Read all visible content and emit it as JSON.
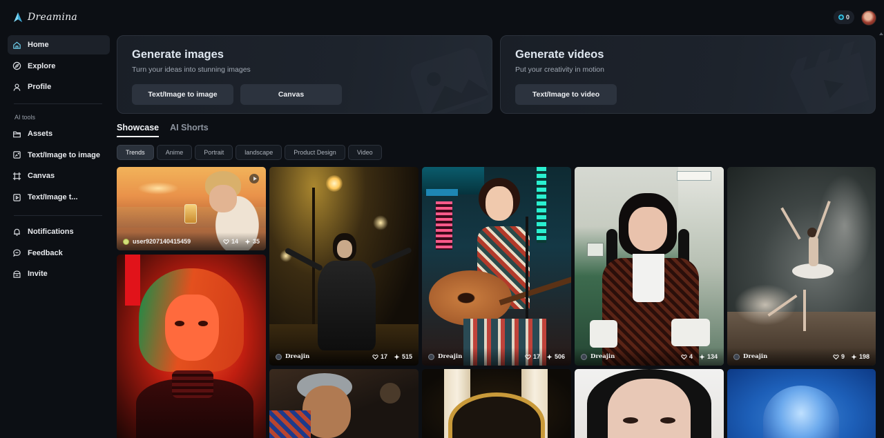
{
  "app": {
    "name": "Dreamina"
  },
  "sidebar": {
    "nav": [
      {
        "label": "Home",
        "icon": "home-icon",
        "active": true
      },
      {
        "label": "Explore",
        "icon": "compass-icon"
      },
      {
        "label": "Profile",
        "icon": "user-icon"
      }
    ],
    "tools_label": "AI tools",
    "tools": [
      {
        "label": "Assets",
        "icon": "folder-icon"
      },
      {
        "label": "Text/Image to image",
        "icon": "image-generate-icon"
      },
      {
        "label": "Canvas",
        "icon": "canvas-icon"
      },
      {
        "label": "Text/Image t...",
        "icon": "video-generate-icon"
      }
    ],
    "footer": [
      {
        "label": "Notifications",
        "icon": "bell-icon"
      },
      {
        "label": "Feedback",
        "icon": "chat-icon"
      },
      {
        "label": "Invite",
        "icon": "gift-icon"
      }
    ]
  },
  "header": {
    "credits": "0"
  },
  "hero": {
    "images": {
      "title": "Generate images",
      "subtitle": "Turn your ideas into stunning images",
      "buttons": [
        "Text/Image to image",
        "Canvas"
      ]
    },
    "videos": {
      "title": "Generate videos",
      "subtitle": "Put your creativity in motion",
      "buttons": [
        "Text/Image to video"
      ]
    }
  },
  "tabs": [
    "Showcase",
    "AI Shorts"
  ],
  "chips": [
    "Trends",
    "Anime",
    "Portrait",
    "landscape",
    "Product Design",
    "Video"
  ],
  "gallery": [
    {
      "user": "user9207140415459",
      "likes": "14",
      "boosts": "35"
    },
    {
      "user": "Dreajin",
      "likes": "17",
      "boosts": "515"
    },
    {
      "user": "Dreajin",
      "likes": "17",
      "boosts": "506"
    },
    {
      "user": "Dreajin",
      "likes": "4",
      "boosts": "134"
    },
    {
      "user": "Dreajin",
      "likes": "9",
      "boosts": "198"
    }
  ],
  "colors": {
    "background": "#0c0f14",
    "panel": "#1c2129",
    "accent": "#34c3e8"
  }
}
